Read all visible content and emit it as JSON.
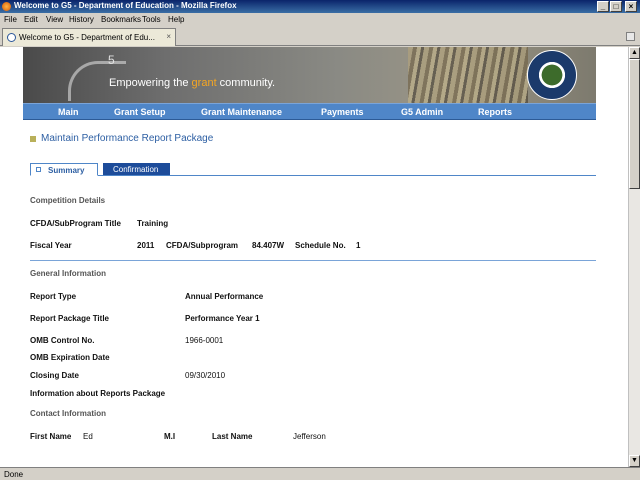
{
  "window": {
    "title": "Welcome to G5 - Department of Education - Mozilla Firefox",
    "minimize": "_",
    "maximize": "□",
    "close": "×"
  },
  "menu": [
    "File",
    "Edit",
    "View",
    "History",
    "Bookmarks",
    "Tools",
    "Help"
  ],
  "tab": {
    "label": "Welcome to G5 - Department of Edu...",
    "close": "×"
  },
  "status": "Done",
  "banner": {
    "logo_sup": "5",
    "tagline_pre": "Empowering the ",
    "tagline_highlight": "grant",
    "tagline_post": " community."
  },
  "nav": [
    "Main",
    "Grant Setup",
    "Grant Maintenance",
    "Payments",
    "G5 Admin",
    "Reports"
  ],
  "page": {
    "title": "Maintain Performance Report Package",
    "tabs": [
      "Summary",
      "Confirmation"
    ]
  },
  "competition": {
    "heading": "Competition Details",
    "title_label": "CFDA/SubProgram Title",
    "title_value": "Training",
    "fy_label": "Fiscal Year",
    "fy_value": "2011",
    "cfda_label": "CFDA/Subprogram",
    "cfda_value": "84.407W",
    "schedule_label": "Schedule No.",
    "schedule_value": "1"
  },
  "general": {
    "heading": "General Information",
    "report_type_label": "Report Type",
    "report_type_value": "Annual Performance",
    "package_title_label": "Report Package Title",
    "package_title_value": "Performance Year 1",
    "omb_label": "OMB Control No.",
    "omb_value": "1966-0001",
    "omb_exp_label": "OMB Expiration Date",
    "closing_label": "Closing Date",
    "closing_value": "09/30/2010",
    "info_label": "Information about Reports Package"
  },
  "contact": {
    "heading": "Contact Information",
    "first_label": "First Name",
    "first_value": "Ed",
    "mi_label": "M.I",
    "last_label": "Last Name",
    "last_value": "Jefferson"
  }
}
